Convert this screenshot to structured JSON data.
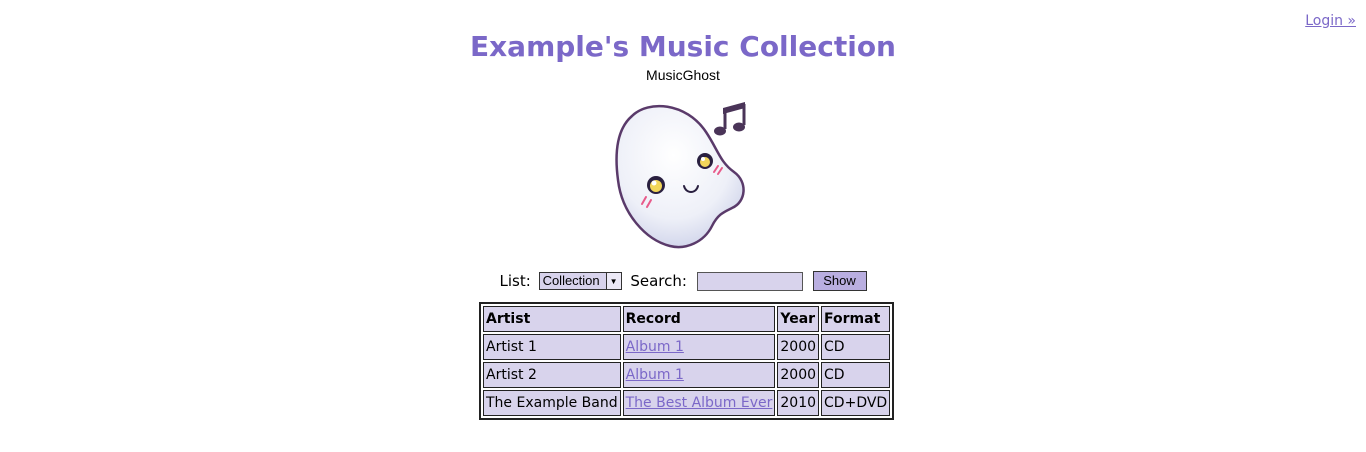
{
  "nav": {
    "login_label": "Login »"
  },
  "header": {
    "title": "Example's Music Collection",
    "subtitle": "MusicGhost"
  },
  "logo": {
    "icon": "music-ghost-logo"
  },
  "controls": {
    "list_label": "List:",
    "list_selected": "Collection",
    "search_label": "Search:",
    "search_value": "",
    "show_label": "Show"
  },
  "table": {
    "headers": [
      "Artist",
      "Record",
      "Year",
      "Format"
    ],
    "rows": [
      [
        "Artist 1",
        "Album 1",
        "2000",
        "CD"
      ],
      [
        "Artist 2",
        "Album 1",
        "2000",
        "CD"
      ],
      [
        "The Example Band",
        "The Best Album Ever",
        "2010",
        "CD+DVD"
      ]
    ]
  },
  "colors": {
    "accent": "#7b68c8",
    "cell_bg": "#d8d3ec",
    "button_bg": "#b9aee0"
  }
}
